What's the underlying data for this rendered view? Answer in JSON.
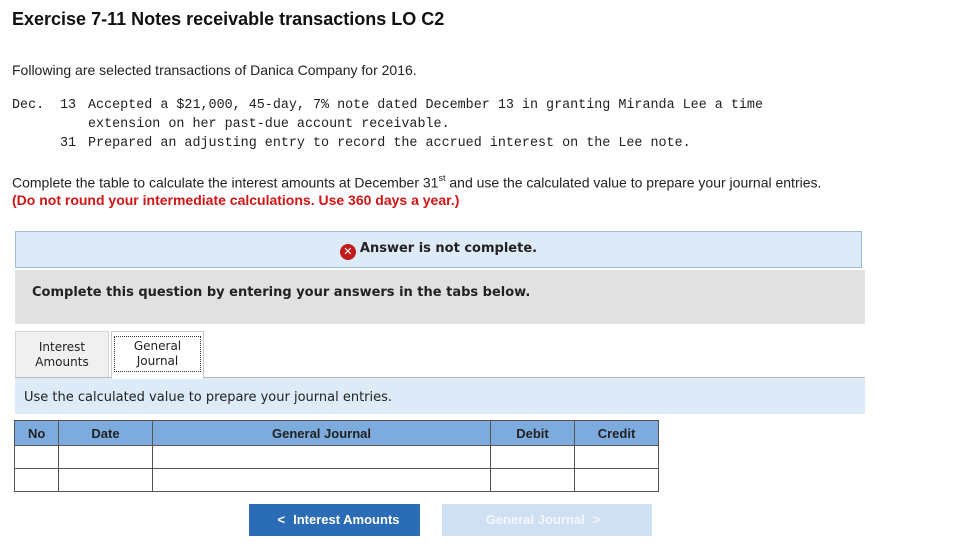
{
  "header": {
    "title": "Exercise 7-11 Notes receivable transactions LO C2"
  },
  "intro": "Following are selected transactions of Danica Company for 2016.",
  "transactions": [
    {
      "month": "Dec.",
      "day": "13",
      "line1": "Accepted a $21,000, 45-day, 7% note dated December 13 in granting Miranda Lee a time",
      "line2": "extension on her past-due account receivable."
    },
    {
      "month": "",
      "day": "31",
      "line1": "Prepared an adjusting entry to record the accrued interest on the Lee note."
    }
  ],
  "instructions": {
    "before": "Complete the table to calculate the interest amounts at December 31",
    "superscript": "st",
    "after": " and use the calculated value to prepare your journal entries.",
    "red": "(Do not round your intermediate calculations. Use 360 days a year.)"
  },
  "status": {
    "icon": "x-circle-icon",
    "text": "Answer is not complete."
  },
  "question_box": "Complete this question by entering your answers in the tabs below.",
  "tabs": [
    {
      "line1": "Interest",
      "line2": "Amounts"
    },
    {
      "line1": "General",
      "line2": "Journal"
    }
  ],
  "active_tab_instruction": "Use the calculated value to prepare your journal entries.",
  "journal_table": {
    "headers": [
      "No",
      "Date",
      "General Journal",
      "Debit",
      "Credit"
    ],
    "rows": [
      [
        "",
        "",
        "",
        "",
        ""
      ],
      [
        "",
        "",
        "",
        "",
        ""
      ]
    ]
  },
  "nav": {
    "prev_label": "Interest Amounts",
    "next_label": "General Journal"
  },
  "colors": {
    "accent": "#2b6cb6",
    "header_blue": "#7dabdd",
    "error_red": "#d11515"
  }
}
